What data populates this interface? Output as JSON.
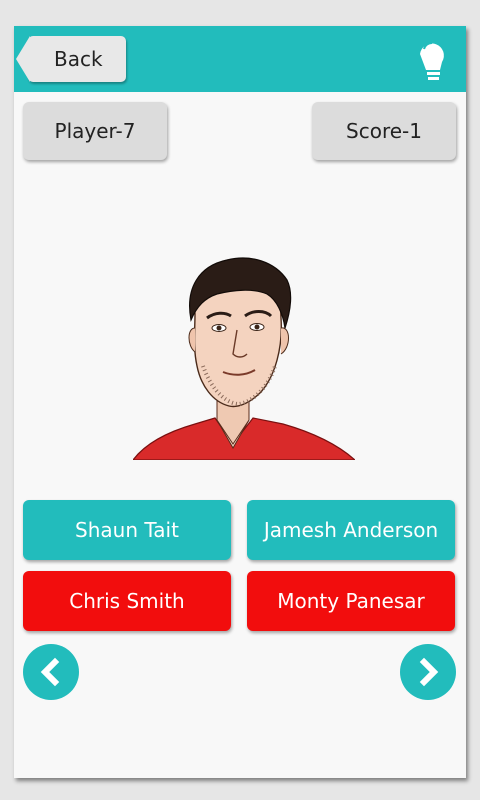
{
  "header": {
    "back_label": "Back",
    "hint_icon": "lightbulb-icon",
    "accent_color": "#22bcbc"
  },
  "status": {
    "player_label": "Player-7",
    "score_label": "Score-1"
  },
  "question": {
    "image": "player-portrait"
  },
  "options": [
    {
      "label": "Shaun Tait",
      "state": "default",
      "color": "#22bcbc"
    },
    {
      "label": "Jamesh Anderson",
      "state": "default",
      "color": "#22bcbc"
    },
    {
      "label": "Chris Smith",
      "state": "wrong",
      "color": "#f20d0d"
    },
    {
      "label": "Monty Panesar",
      "state": "wrong",
      "color": "#f20d0d"
    }
  ],
  "navigation": {
    "prev_icon": "chevron-left-icon",
    "next_icon": "chevron-right-icon"
  }
}
